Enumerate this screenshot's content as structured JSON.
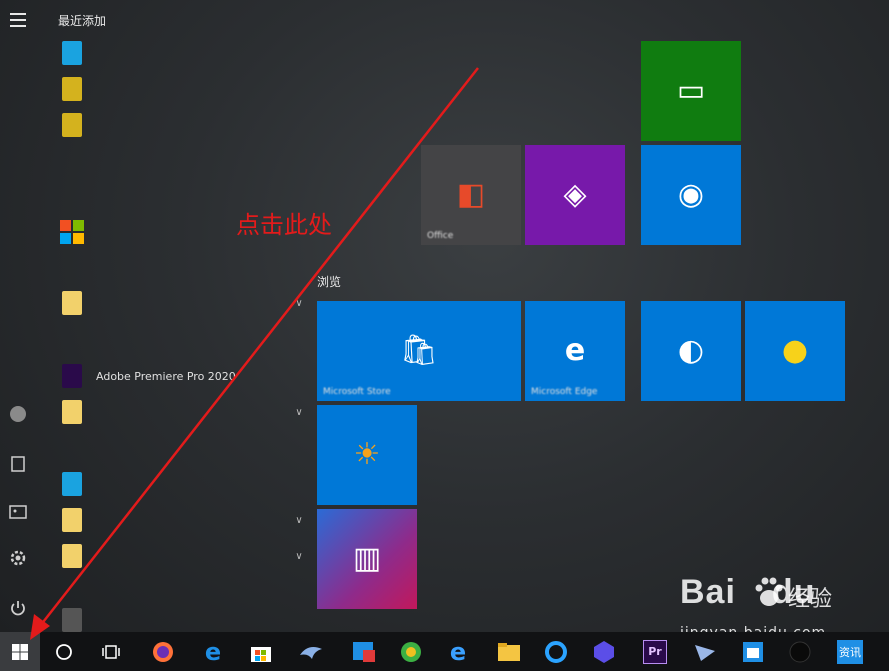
{
  "sections": {
    "recently_added": "最近添加",
    "browse_group": "浏览",
    "group_left_top": "",
    "group_right_top": ""
  },
  "recent_apps": [
    {
      "name": "",
      "color": "#1aa3e0"
    },
    {
      "name": "",
      "color": "#d4b21e"
    },
    {
      "name": "",
      "color": "#d4b21e"
    }
  ],
  "letters": [
    "",
    "",
    "",
    "",
    ""
  ],
  "apps": [
    {
      "name": "",
      "color": "#0e72c6"
    },
    {
      "name": "",
      "color": "#f2d16b"
    },
    {
      "name": "Adobe Premiere Pro 2020",
      "color": "#2a0a4a"
    },
    {
      "name": "",
      "color": "#f2d16b"
    },
    {
      "name": "",
      "color": "#1aa3e0"
    },
    {
      "name": "",
      "color": "#f2d16b"
    },
    {
      "name": "",
      "color": "#f2d16b"
    },
    {
      "name": "",
      "color": "#555555"
    }
  ],
  "tiles": [
    {
      "label": "",
      "color": "#107c10",
      "glyph": "▭"
    },
    {
      "label": "Office",
      "color": "#444446",
      "glyph": "◧"
    },
    {
      "label": "",
      "color": "#7719aa",
      "glyph": "◈"
    },
    {
      "label": "",
      "color": "#0078d7",
      "glyph": "◉"
    },
    {
      "label": "Microsoft Store",
      "color": "#0078d7",
      "glyph": "🛍"
    },
    {
      "label": "Microsoft Edge",
      "color": "#0078d7",
      "glyph": "e"
    },
    {
      "label": "",
      "color": "#0078d7",
      "glyph": "◐"
    },
    {
      "label": "",
      "color": "#0078d7",
      "glyph": "●"
    },
    {
      "label": "",
      "color": "#0078d7",
      "glyph": "☀"
    },
    {
      "label": "",
      "color": "#8e2b8b",
      "glyph": "▥"
    }
  ],
  "annotation": "点击此处",
  "watermark": {
    "main": "Bai",
    "du": "du",
    "cn": "经验",
    "sub": "jingyan.baidu.com"
  },
  "taskbar": {
    "news_badge": "资讯",
    "premiere_label": "Pr"
  },
  "colors": {
    "accent_red": "#e31b1b",
    "tile_blue": "#0078d7",
    "taskbar": "#111214"
  }
}
